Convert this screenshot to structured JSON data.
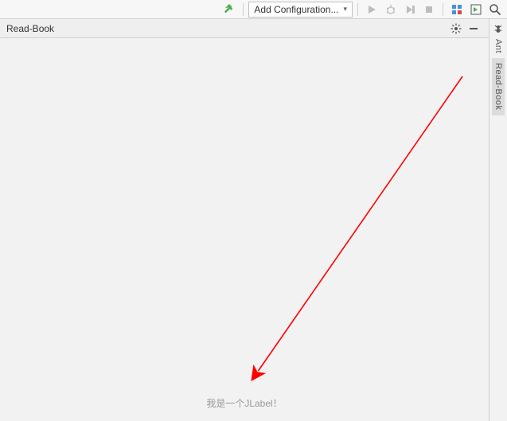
{
  "toolbar": {
    "config_label": "Add Configuration..."
  },
  "panel": {
    "title": "Read-Book"
  },
  "content": {
    "jlabel_text": "我是一个JLabel！"
  },
  "rail": {
    "tabs": [
      {
        "label": "Ant"
      },
      {
        "label": "Read-Book"
      }
    ]
  }
}
